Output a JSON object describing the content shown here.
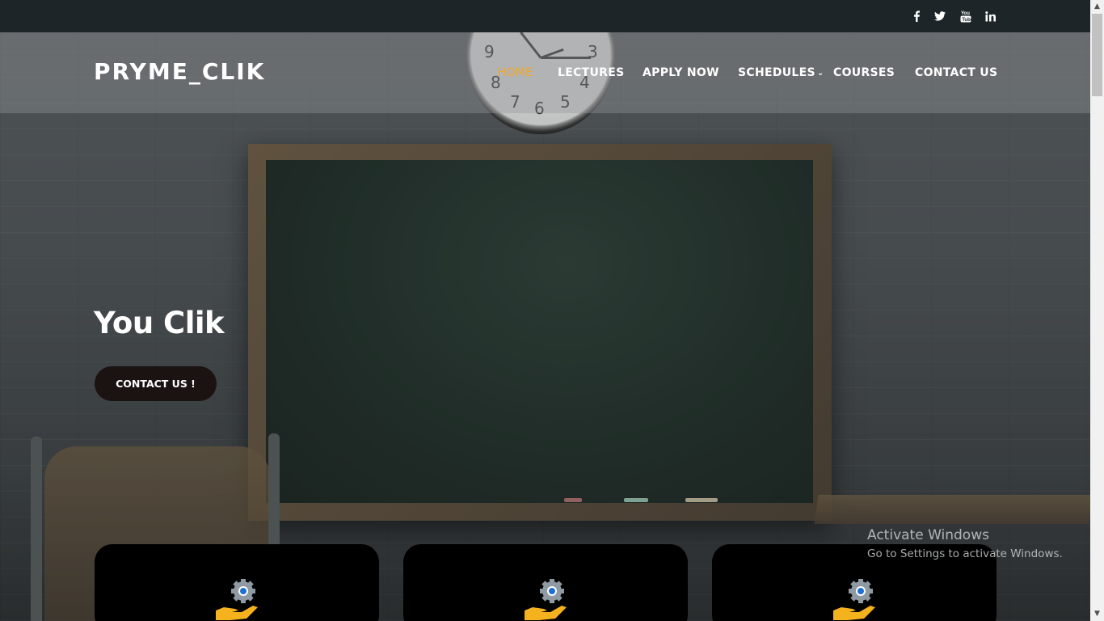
{
  "topbar": {
    "social": [
      {
        "icon": "facebook-icon",
        "glyph": "f"
      },
      {
        "icon": "twitter-icon",
        "glyph": "t"
      },
      {
        "icon": "youtube-icon",
        "glyph": "yt"
      },
      {
        "icon": "linkedin-icon",
        "glyph": "in"
      }
    ]
  },
  "header": {
    "logo": "PRYME_CLIK",
    "nav": [
      {
        "label": "HOME",
        "active": true
      },
      {
        "label": "LECTURES",
        "active": false
      },
      {
        "label": "APPLY NOW",
        "active": false
      },
      {
        "label": "SCHEDULES",
        "active": false,
        "dropdown": true
      },
      {
        "label": "COURSES",
        "active": false
      },
      {
        "label": "CONTACT US",
        "active": false
      }
    ],
    "active_color": "#f5a623"
  },
  "hero": {
    "title": "You Clik",
    "button_label": "CONTACT US !"
  },
  "cards": [
    {
      "icon": "gear-hand-icon"
    },
    {
      "icon": "gear-hand-icon"
    },
    {
      "icon": "gear-hand-icon"
    }
  ],
  "watermark": {
    "title": "Activate Windows",
    "subtitle": "Go to Settings to activate Windows."
  }
}
